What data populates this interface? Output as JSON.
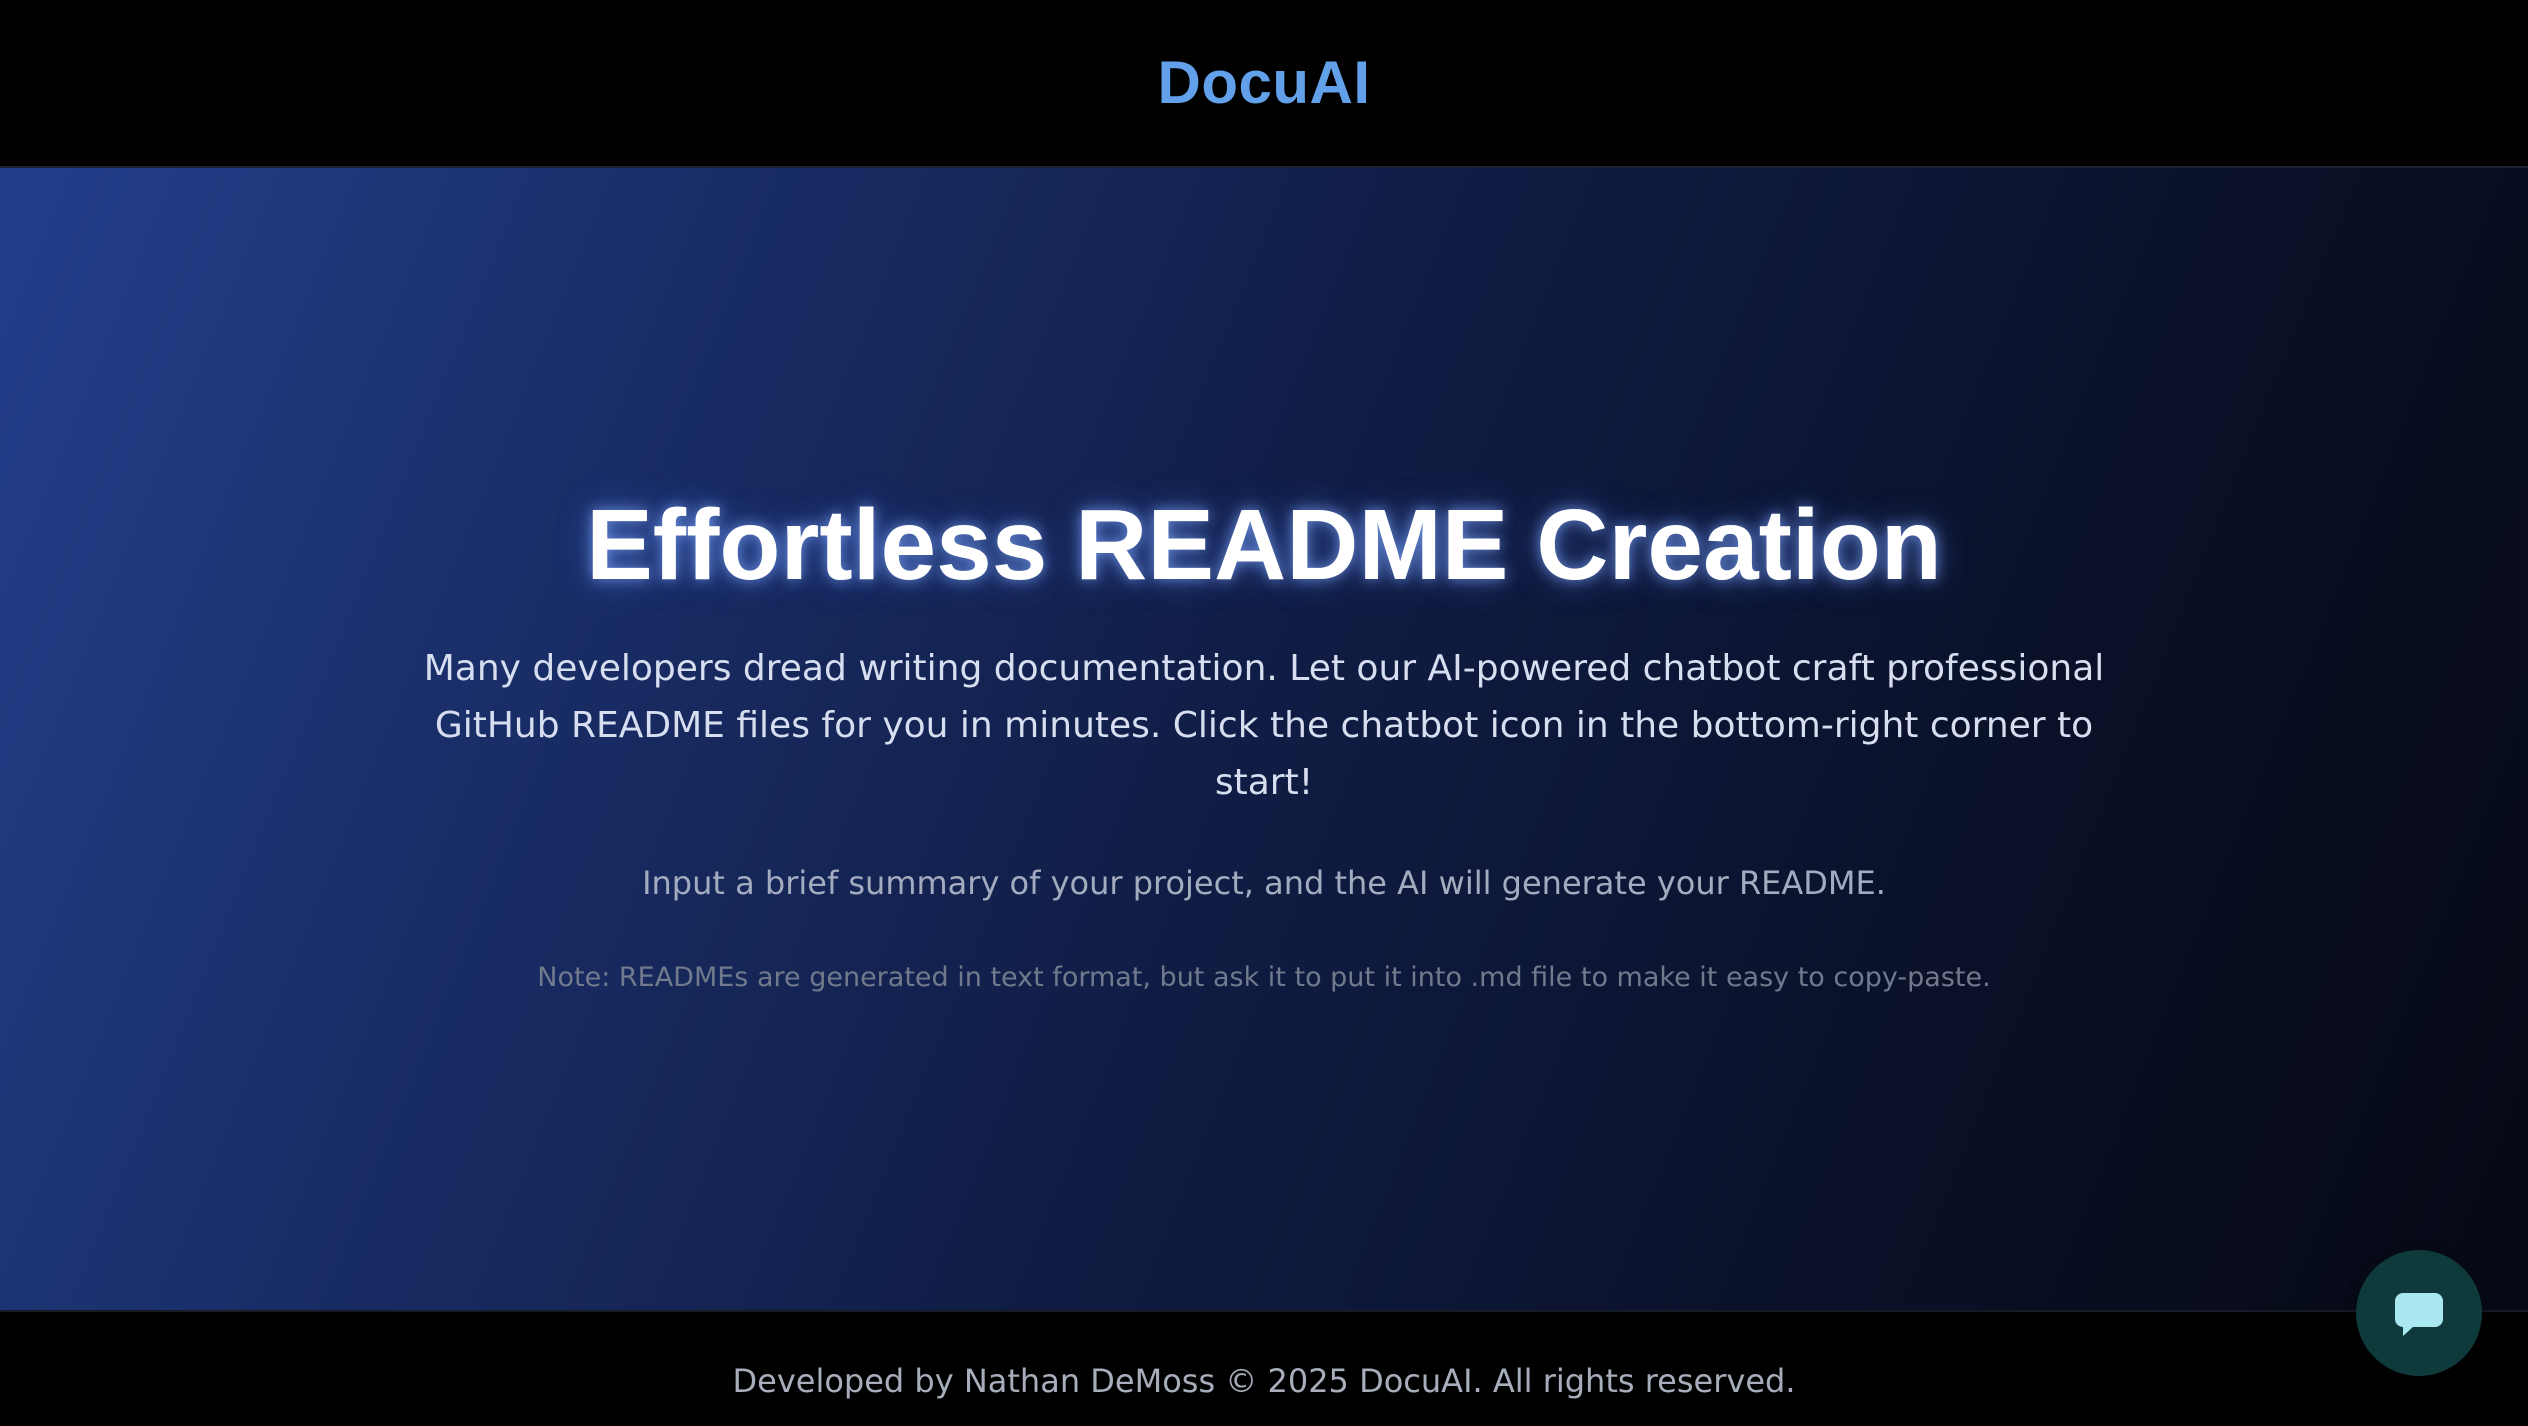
{
  "header": {
    "brand": "DocuAI",
    "brand_color": "#62a0ea"
  },
  "hero": {
    "headline": "Effortless README Creation",
    "description": "Many developers dread writing documentation. Let our AI-powered chatbot craft professional GitHub README files for you in minutes. Click the chatbot icon in the bottom-right corner to start!",
    "instruction": "Input a brief summary of your project, and the AI will generate your README.",
    "note": "Note: READMEs are generated in text format, but ask it to put it into .md file to make it easy to copy-paste.",
    "gradient_colors": [
      "#233f8c",
      "#060914"
    ]
  },
  "footer": {
    "text": "Developed by Nathan DeMoss © 2025 DocuAI. All rights reserved."
  },
  "chat_launcher": {
    "icon": "chat-bubble-icon",
    "background_color": "#0f3a3c",
    "icon_color": "#a9e8f0"
  }
}
